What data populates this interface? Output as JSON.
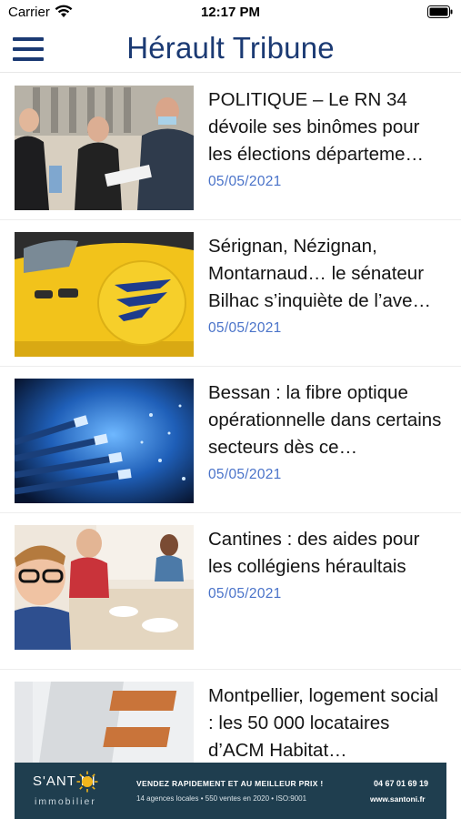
{
  "status_bar": {
    "carrier": "Carrier",
    "time": "12:17 PM"
  },
  "header": {
    "title": "Hérault Tribune"
  },
  "articles": [
    {
      "title": "POLITIQUE – Le RN 34 dévoile ses binômes pour les élections départeme…",
      "date": "05/05/2021"
    },
    {
      "title": "Sérignan, Nézignan, Montarnaud… le sénateur Bilhac s’inquiète de l’ave…",
      "date": "05/05/2021"
    },
    {
      "title": "Bessan : la fibre optique opérationnelle dans certains secteurs dès ce…",
      "date": "05/05/2021"
    },
    {
      "title": "Cantines : des aides pour les collégiens héraultais",
      "date": "05/05/2021"
    },
    {
      "title": "Montpellier, logement social : les 50 000 locataires d’ACM Habitat…",
      "date": ""
    }
  ],
  "ad": {
    "brand": "S'ANT  NI",
    "brand_sub": "immobilier",
    "tagline": "VENDEZ RAPIDEMENT ET AU MEILLEUR PRIX !",
    "subline": "14 agences locales • 550 ventes en 2020 • ISO:9001",
    "phone": "04 67 01 69 19",
    "website": "www.santoni.fr"
  },
  "colors": {
    "brand_blue": "#1b3a73",
    "date_blue": "#4a73c9",
    "ad_bg": "#1f3e4f"
  }
}
